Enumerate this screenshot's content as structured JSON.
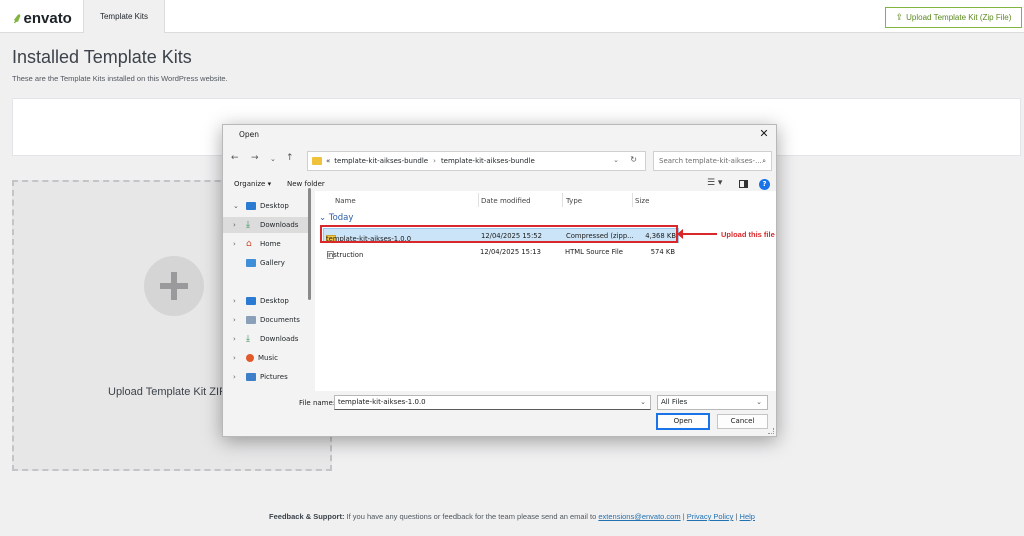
{
  "topbar": {
    "logo": "envato",
    "active_tab": "Template Kits",
    "upload_button": "Upload Template Kit (Zip File)"
  },
  "page": {
    "title": "Installed Template Kits",
    "description": "These are the Template Kits installed on this WordPress website.",
    "upload_card_label": "Upload Template Kit ZIP"
  },
  "footer": {
    "prefix": "Feedback & Support:",
    "text": " If you have any questions or feedback for the team please send an email to ",
    "email": "extensions@envato.com",
    "sep1": " | ",
    "privacy": "Privacy Policy",
    "sep2": " | ",
    "help": "Help"
  },
  "dialog": {
    "title": "Open",
    "path": [
      "template-kit-aikses-bundle",
      "template-kit-aikses-bundle"
    ],
    "path_prefix": "«",
    "search_placeholder": "Search template-kit-aikses-...",
    "organize": "Organize",
    "new_folder": "New folder",
    "nav": [
      {
        "label": "Desktop",
        "chev": "⌄"
      },
      {
        "label": "Downloads",
        "chev": "›"
      },
      {
        "label": "Home",
        "chev": "›"
      },
      {
        "label": "Gallery",
        "chev": ""
      },
      {
        "label": "Desktop",
        "chev": "›"
      },
      {
        "label": "Documents",
        "chev": "›"
      },
      {
        "label": "Downloads",
        "chev": "›"
      },
      {
        "label": "Music",
        "chev": "›"
      },
      {
        "label": "Pictures",
        "chev": "›"
      }
    ],
    "columns": [
      "Name",
      "Date modified",
      "Type",
      "Size"
    ],
    "group": "Today",
    "files": [
      {
        "name": "template-kit-aikses-1.0.0",
        "date": "12/04/2025 15:52",
        "type": "Compressed (zipp...",
        "size": "4,368 KB"
      },
      {
        "name": "instruction",
        "date": "12/04/2025 15:13",
        "type": "HTML Source File",
        "size": "574 KB"
      }
    ],
    "filename_label": "File name:",
    "filename_value": "template-kit-aikses-1.0.0",
    "filter": "All Files",
    "open_button": "Open",
    "cancel_button": "Cancel"
  },
  "annotation": {
    "label": "Upload this file",
    "color": "#d9282b"
  },
  "colors": {
    "brand": "#82b440",
    "link": "#2271b1",
    "selection": "#cce4f7"
  }
}
